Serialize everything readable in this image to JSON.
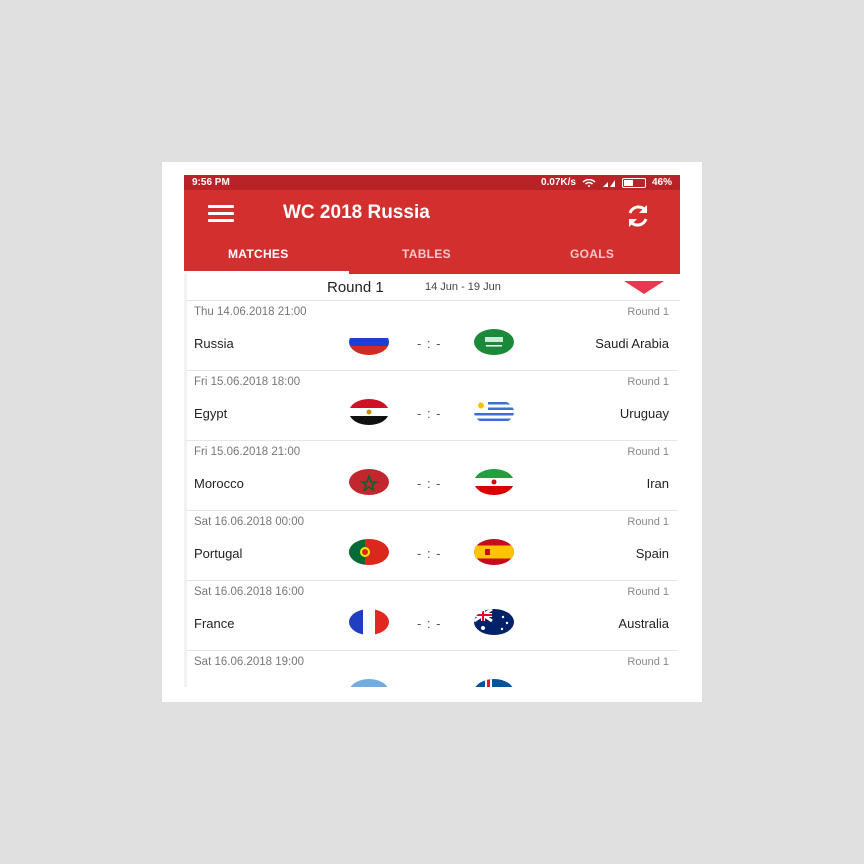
{
  "status_bar": {
    "time": "9:56 PM",
    "speed": "0.07K/s",
    "battery": "46%"
  },
  "toolbar": {
    "title": "WC 2018 Russia",
    "menu_icon": "hamburger-menu-icon",
    "refresh_icon": "refresh-icon"
  },
  "tabs": [
    {
      "label": "MATCHES",
      "active": true
    },
    {
      "label": "TABLES",
      "active": false
    },
    {
      "label": "GOALS",
      "active": false
    }
  ],
  "round_selector": {
    "round": "Round 1",
    "dates": "14 Jun - 19 Jun",
    "accent": "#e53950"
  },
  "colors": {
    "primary": "#d32f2f",
    "status_bar": "#b92327"
  },
  "matches": [
    {
      "date": "Thu 14.06.2018 21:00",
      "round": "Round 1",
      "home": "Russia",
      "away": "Saudi Arabia",
      "score": "- : -",
      "home_flag": "russia",
      "away_flag": "saudi-arabia"
    },
    {
      "date": "Fri 15.06.2018 18:00",
      "round": "Round 1",
      "home": "Egypt",
      "away": "Uruguay",
      "score": "- : -",
      "home_flag": "egypt",
      "away_flag": "uruguay"
    },
    {
      "date": "Fri 15.06.2018 21:00",
      "round": "Round 1",
      "home": "Morocco",
      "away": "Iran",
      "score": "- : -",
      "home_flag": "morocco",
      "away_flag": "iran"
    },
    {
      "date": "Sat 16.06.2018 00:00",
      "round": "Round 1",
      "home": "Portugal",
      "away": "Spain",
      "score": "- : -",
      "home_flag": "portugal",
      "away_flag": "spain"
    },
    {
      "date": "Sat 16.06.2018 16:00",
      "round": "Round 1",
      "home": "France",
      "away": "Australia",
      "score": "- : -",
      "home_flag": "france",
      "away_flag": "australia"
    },
    {
      "date": "Sat 16.06.2018 19:00",
      "round": "Round 1",
      "home": "",
      "away": "",
      "score": "",
      "home_flag": "argentina",
      "away_flag": "iceland"
    }
  ]
}
